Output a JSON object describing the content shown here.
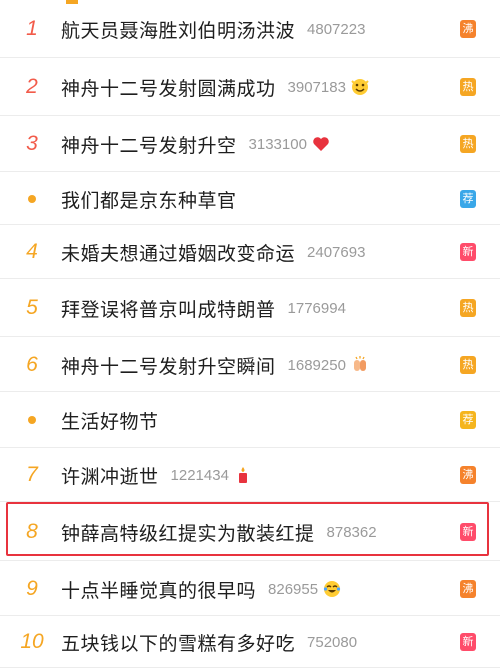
{
  "colors": {
    "rank_top3": "#f25b4a",
    "rank_other": "#f5a623",
    "badge_boil": "#f5822c",
    "badge_hot": "#f5a623",
    "badge_new": "#ff4c6a",
    "badge_recommend": "#3aa7e8",
    "badge_good": "#f5b51e",
    "highlight_border": "#e8333e"
  },
  "items": [
    {
      "rank": "1",
      "title": "航天员聂海胜刘伯明汤洪波",
      "count": "4807223",
      "emoji": "",
      "badge": "沸",
      "badge_type": "boil"
    },
    {
      "rank": "2",
      "title": "神舟十二号发射圆满成功",
      "count": "3907183",
      "emoji": "cheering-face-icon",
      "badge": "热",
      "badge_type": "hot"
    },
    {
      "rank": "3",
      "title": "神舟十二号发射升空",
      "count": "3133100",
      "emoji": "red-heart-icon",
      "badge": "热",
      "badge_type": "hot"
    },
    {
      "rank": "",
      "title": "我们都是京东种草官",
      "count": "",
      "emoji": "",
      "badge": "荐",
      "badge_type": "recommend"
    },
    {
      "rank": "4",
      "title": "未婚夫想通过婚姻改变命运",
      "count": "2407693",
      "emoji": "",
      "badge": "新",
      "badge_type": "new"
    },
    {
      "rank": "5",
      "title": "拜登误将普京叫成特朗普",
      "count": "1776994",
      "emoji": "",
      "badge": "热",
      "badge_type": "hot"
    },
    {
      "rank": "6",
      "title": "神舟十二号发射升空瞬间",
      "count": "1689250",
      "emoji": "clapping-hands-icon",
      "badge": "热",
      "badge_type": "hot"
    },
    {
      "rank": "",
      "title": "生活好物节",
      "count": "",
      "emoji": "",
      "badge": "荐",
      "badge_type": "good"
    },
    {
      "rank": "7",
      "title": "许渊冲逝世",
      "count": "1221434",
      "emoji": "candle-icon",
      "badge": "沸",
      "badge_type": "boil"
    },
    {
      "rank": "8",
      "title": "钟薛高特级红提实为散装红提",
      "count": "878362",
      "emoji": "",
      "badge": "新",
      "badge_type": "new",
      "highlighted": true
    },
    {
      "rank": "9",
      "title": "十点半睡觉真的很早吗",
      "count": "826955",
      "emoji": "laughing-tears-face-icon",
      "badge": "沸",
      "badge_type": "boil"
    },
    {
      "rank": "10",
      "title": "五块钱以下的雪糕有多好吃",
      "count": "752080",
      "emoji": "",
      "badge": "新",
      "badge_type": "new"
    }
  ]
}
